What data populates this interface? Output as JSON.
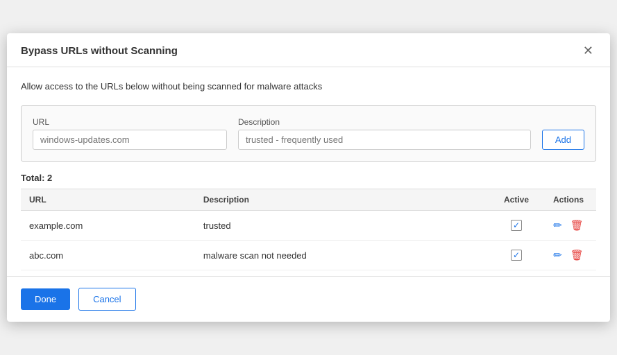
{
  "dialog": {
    "title": "Bypass URLs without Scanning",
    "description": "Allow access to the URLs below without being scanned for malware attacks"
  },
  "form": {
    "url_label": "URL",
    "url_placeholder": "windows-updates.com",
    "description_label": "Description",
    "description_placeholder": "trusted - frequently used",
    "add_button": "Add"
  },
  "table": {
    "total_label": "Total:",
    "total_count": "2",
    "columns": {
      "url": "URL",
      "description": "Description",
      "active": "Active",
      "actions": "Actions"
    },
    "rows": [
      {
        "url": "example.com",
        "description": "trusted",
        "active": true
      },
      {
        "url": "abc.com",
        "description": "malware scan not needed",
        "active": true
      }
    ]
  },
  "footer": {
    "done_label": "Done",
    "cancel_label": "Cancel"
  },
  "icons": {
    "close": "✕",
    "edit": "✏",
    "delete": "🗑",
    "checkmark": "✓"
  }
}
